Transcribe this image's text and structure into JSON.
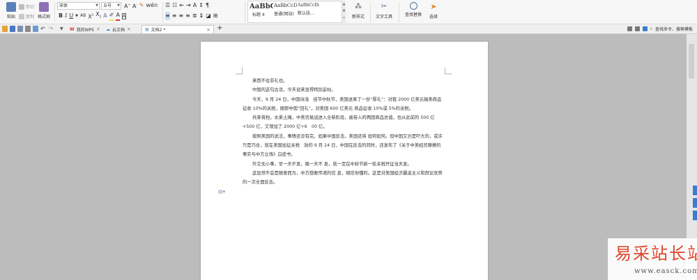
{
  "ribbon": {
    "paste_label": "粘贴",
    "cut_label": "剪切",
    "copy_label": "复制",
    "format_painter_label": "格式刷",
    "font_name": "宋体",
    "font_size": "五号",
    "styles": [
      {
        "preview": "AaBbC",
        "name": "标题 4"
      },
      {
        "preview": "AaBbCcD",
        "name": "普通(网站)"
      },
      {
        "preview": "AaBbCcDi",
        "name": "默认段..."
      }
    ],
    "new_style_label": "新样式",
    "text_tools_label": "文字工具",
    "find_replace_label": "查找替换",
    "select_label": "选择"
  },
  "tabs": [
    {
      "label": "我的WPS"
    },
    {
      "label": "云文档"
    },
    {
      "label": "文档2 *"
    }
  ],
  "search_command_label": "查找命令、搜索模板",
  "document": {
    "paragraphs": [
      "来而不往非礼也。",
      "中国的这句古话，今天说来显得特别妥帖。",
      "今天，9 月 24 日，中国诗浅　佳节中秋节，美国送来了一份“厚礼”：对我 2000 亿美元输美商品征收 10%的关税，随即中国“回礼”，对美国 600 亿美元 商品征收 10%或 5%的关税。",
      "兵来将挡，水来土掩，中美贸易战进入全新阶段，被卷入的两国商品总值，也从此前的 500 亿+500 亿，又增加了 2000 亿+6　00 亿。",
      "按照美国的说法，事情还没有完，如果中国反击，美国还将 如何如何。但中国又岂是吓大的，或许只是巧合，就在美国加征关税　效的 9 月 24 日，中国在反击的同时，还发布了《关于中美经贸摩擦的 事实与中方立场》白皮书。",
      "外交无小事，早一天不发，晚一天不 发，就一定在中秋节新一轮关税开征当天发。",
      "这显然不会是随意而为，中方想要传递的信 息，相信你懂的。这是对美国经济霸凌主义和舆论攻势的一次全面反击。"
    ]
  },
  "watermark": {
    "title": "易采站长站",
    "url": "www.easck.com"
  },
  "colors": {
    "wps_red": "#d9342b",
    "accent_blue": "#3c7bd0",
    "watermark_red": "#e0452b"
  }
}
